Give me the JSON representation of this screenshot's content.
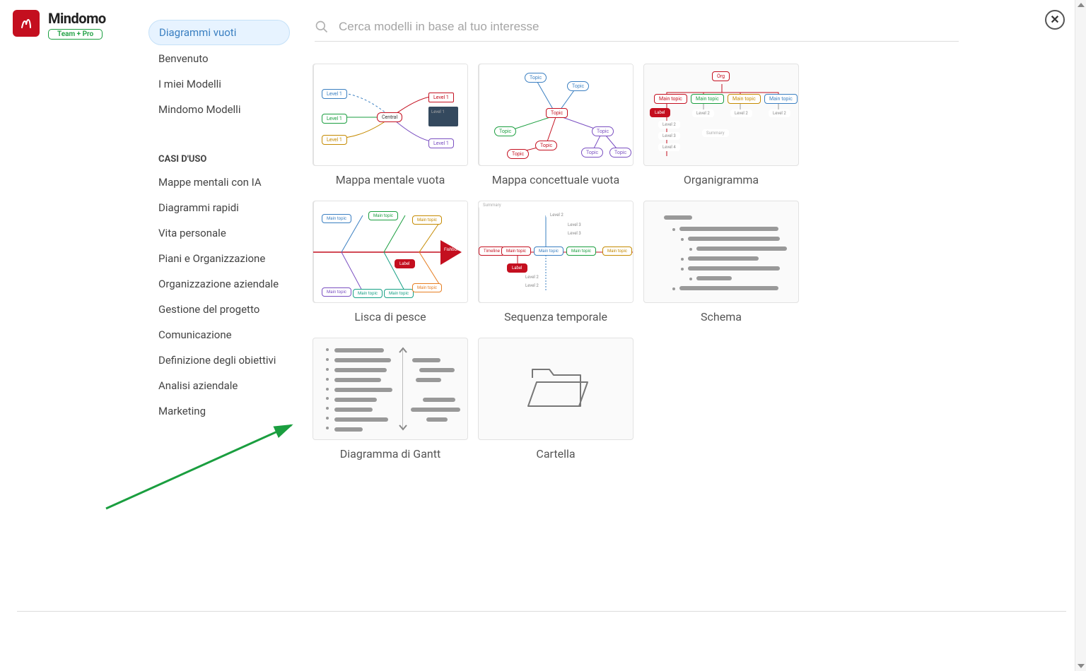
{
  "brand": {
    "name": "Mindomo",
    "plan": "Team + Pro"
  },
  "search": {
    "placeholder": "Cerca modelli in base al tuo interesse"
  },
  "sidebar": {
    "top": [
      {
        "label": "Diagrammi vuoti",
        "active": true
      },
      {
        "label": "Benvenuto"
      },
      {
        "label": "I miei Modelli"
      },
      {
        "label": "Mindomo Modelli"
      }
    ],
    "section_title": "CASI D'USO",
    "usecases": [
      {
        "label": "Mappe mentali con IA"
      },
      {
        "label": "Diagrammi rapidi"
      },
      {
        "label": "Vita personale"
      },
      {
        "label": "Piani e Organizzazione"
      },
      {
        "label": "Organizzazione aziendale"
      },
      {
        "label": "Gestione del progetto"
      },
      {
        "label": "Comunicazione"
      },
      {
        "label": "Definizione degli obiettivi"
      },
      {
        "label": "Analisi aziendale"
      },
      {
        "label": "Marketing"
      }
    ]
  },
  "templates": [
    {
      "label": "Mappa mentale vuota",
      "kind": "mindmap"
    },
    {
      "label": "Mappa concettuale vuota",
      "kind": "concept"
    },
    {
      "label": "Organigramma",
      "kind": "org"
    },
    {
      "label": "Lisca di pesce",
      "kind": "fishbone"
    },
    {
      "label": "Sequenza temporale",
      "kind": "timeline"
    },
    {
      "label": "Schema",
      "kind": "outline"
    },
    {
      "label": "Diagramma di Gantt",
      "kind": "gantt"
    },
    {
      "label": "Cartella",
      "kind": "folder"
    }
  ],
  "thumb_text": {
    "central": "Central",
    "level1": "Level 1",
    "topic": "Topic",
    "org": "Org",
    "main_topic": "Main topic",
    "level2": "Level 2",
    "level3": "Level 3",
    "level4": "Level 4",
    "label": "Label",
    "summary": "Summary",
    "fishbone": "Fishbone",
    "timeline": "Timeline"
  }
}
